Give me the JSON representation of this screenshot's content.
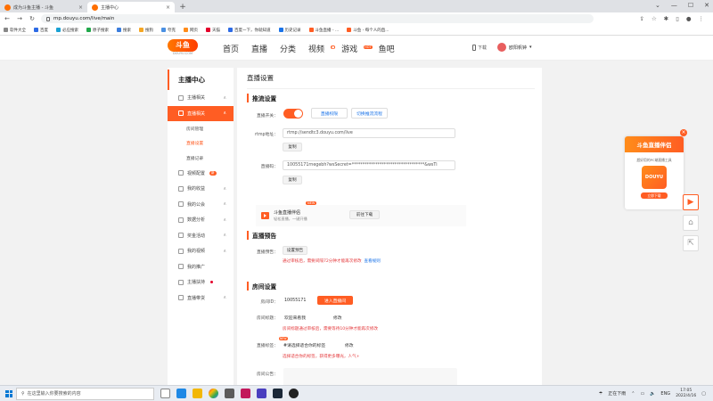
{
  "browser": {
    "tabs": [
      {
        "label": "成为斗鱼主播 - 斗鱼",
        "active": false
      },
      {
        "label": "主播中心",
        "active": true
      }
    ],
    "new_tab": "+",
    "url": "mp.douyu.com/live/main",
    "bookmarks": [
      "软件大全",
      "百度",
      "必应搜索",
      "原子搜索",
      "搜索",
      "搜狗",
      "夸克",
      "网页",
      "天猫",
      "百度一下，你就知道",
      "历史记录",
      "斗鱼直播 - ...",
      "斗鱼 - 每个人的直..."
    ]
  },
  "header": {
    "logo_text": "斗鱼",
    "logo_sub": "DOUYU.COM",
    "nav": [
      {
        "label": "首页"
      },
      {
        "label": "直播"
      },
      {
        "label": "分类"
      },
      {
        "label": "视频",
        "badge": "●"
      },
      {
        "label": "游戏",
        "badge": "HOT"
      },
      {
        "label": "鱼吧"
      }
    ],
    "download": "下载",
    "username": "欧阳帆钟"
  },
  "sidebar": {
    "title": "主播中心",
    "items": [
      {
        "label": "主播相关",
        "chevron": "∧"
      },
      {
        "label": "直播相关",
        "chevron": "∧",
        "active": true
      },
      {
        "label": "房间管理",
        "sub": true
      },
      {
        "label": "直播设置",
        "sub": true,
        "current": true
      },
      {
        "label": "直播记录",
        "sub": true
      },
      {
        "label": "视频配置",
        "badge": "新"
      },
      {
        "label": "我的收益",
        "chevron": "∧"
      },
      {
        "label": "我的公会",
        "chevron": "∧"
      },
      {
        "label": "数据分析",
        "chevron": "∧"
      },
      {
        "label": "奖金活动",
        "chevron": "∧"
      },
      {
        "label": "我的视频",
        "chevron": "∧"
      },
      {
        "label": "我的推广"
      },
      {
        "label": "主播扶持",
        "dot": true
      },
      {
        "label": "直播带货",
        "chevron": "∧"
      }
    ]
  },
  "main": {
    "page_title": "直播设置",
    "push": {
      "section": "推流设置",
      "switch_label": "直播开关：",
      "btn_upgrade": "直播权限",
      "btn_tutorial": "切换推流流程",
      "rtmp_label": "rtmp地址：",
      "rtmp_value": "rtmp://sendtc3.douyu.com/live",
      "copy1": "复制",
      "code_label": "直播码：",
      "code_value": "10055171rnegebh?wsSecret=**********************************&wsTi",
      "copy2": "复制",
      "promo_title": "斗鱼直播伴侣",
      "promo_sub": "轻松直播，一键开播",
      "promo_new": "NEW",
      "promo_btn": "前往下载"
    },
    "preview": {
      "section": "直播预告",
      "label": "直播预告：",
      "btn": "设置预告",
      "warn": "通过审核后，需要间隔72分钟才能再次修改",
      "warn_link": "查看规则"
    },
    "room": {
      "section": "房间设置",
      "id_label": "房间ID：",
      "id_value": "10055171",
      "enter_btn": "进入直播间",
      "title_label": "房间标题：",
      "title_value": "欢迎来看我",
      "title_edit": "修改",
      "title_warn": "房间标题通过审核后，需要等待10分钟才能再次修改",
      "tag_label": "直播标签：",
      "tag_new": "NEW",
      "tag_value": "#请选择适合你的标签",
      "tag_edit": "修改",
      "tag_warn": "选择适合你的标签，获得更多曝光，人气+",
      "notice_label": "房间公告："
    }
  },
  "float": {
    "ad_title": "斗鱼直播伴侣",
    "ad_desc": "超好用的PC端直播工具",
    "ad_app": "DOUYU",
    "ad_btn": "立即下载",
    "close": "×"
  },
  "taskbar": {
    "search_placeholder": "在这里输入你要搜索的内容",
    "weather": "正在下雨",
    "lang": "ENG",
    "time": "17:05",
    "date": "2022/4/16"
  },
  "colors": {
    "accent": "#ff5d23",
    "link": "#1a73e8",
    "warn": "#e4393c"
  }
}
